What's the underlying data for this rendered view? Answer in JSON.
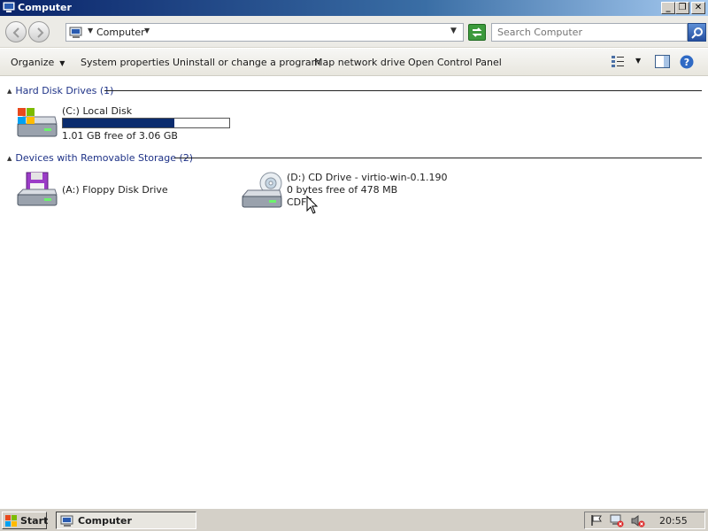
{
  "window": {
    "title": "Computer"
  },
  "address": {
    "crumb": "Computer",
    "search_placeholder": "Search Computer"
  },
  "toolbar": {
    "organize": "Organize",
    "system_properties": "System properties",
    "uninstall": "Uninstall or change a program",
    "map_network": "Map network drive",
    "control_panel": "Open Control Panel"
  },
  "groups": {
    "hard_disk": {
      "header": "Hard Disk Drives (1)",
      "drives": [
        {
          "name": "(C:) Local Disk",
          "free_text": "1.01 GB free of 3.06 GB",
          "used_fraction": 0.67
        }
      ]
    },
    "removable": {
      "header": "Devices with Removable Storage (2)",
      "drives": [
        {
          "name": "(A:) Floppy Disk Drive"
        },
        {
          "name": "(D:) CD Drive - virtio-win-0.1.190",
          "free_text": "0 bytes free of 478 MB",
          "fs": "CDFS"
        }
      ]
    }
  },
  "taskbar": {
    "start": "Start",
    "task": "Computer",
    "clock": "20:55"
  },
  "colors": {
    "accent": "#0b2c6e",
    "group_header": "#1e3287"
  }
}
